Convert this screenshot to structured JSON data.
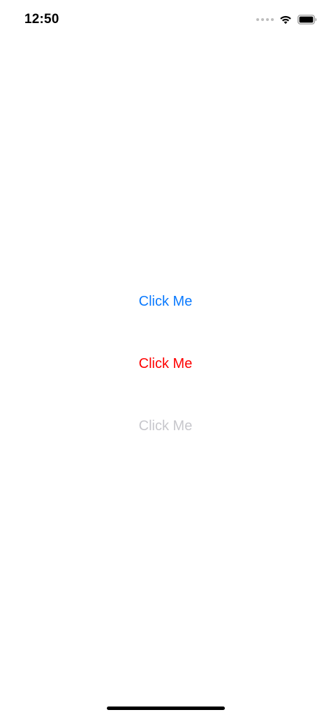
{
  "status_bar": {
    "time": "12:50",
    "icons": [
      "signal-dots-icon",
      "wifi-icon",
      "battery-icon"
    ]
  },
  "buttons": [
    {
      "label": "Click Me",
      "color": "#0a7aff",
      "enabled": true
    },
    {
      "label": "Click Me",
      "color": "#ff0000",
      "enabled": true
    },
    {
      "label": "Click Me",
      "color": "#c7c7cc",
      "enabled": false
    }
  ]
}
